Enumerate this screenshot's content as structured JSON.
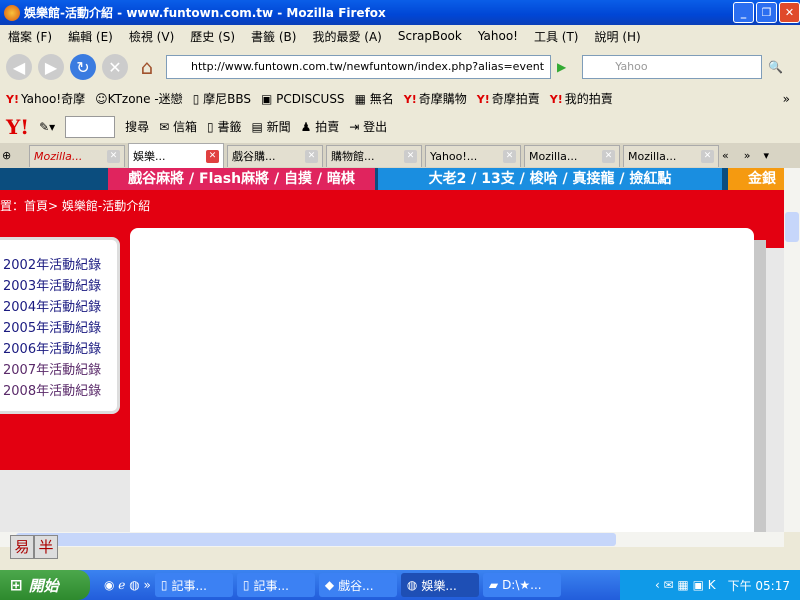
{
  "window": {
    "title": "娛樂館-活動介紹 - www.funtown.com.tw - Mozilla Firefox"
  },
  "menu": [
    "檔案 (F)",
    "編輯 (E)",
    "檢視 (V)",
    "歷史 (S)",
    "書籤 (B)",
    "我的最愛 (A)",
    "ScrapBook",
    "Yahoo!",
    "工具 (T)",
    "說明 (H)"
  ],
  "nav": {
    "url": "http://www.funtown.com.tw/newfuntown/index.php?alias=event",
    "search_placeholder": "Yahoo"
  },
  "bookmarks": [
    "Yahoo!奇摩",
    "KTzone -迷戀",
    "摩尼BBS",
    "PCDISCUSS",
    "無名",
    "奇摩購物",
    "奇摩拍賣",
    "我的拍賣"
  ],
  "yahoo_toolbar": {
    "logo": "Y!",
    "items": [
      "搜尋",
      "信箱",
      "書籤",
      "新聞",
      "拍賣",
      "登出"
    ]
  },
  "tabs": [
    {
      "label": "Mozilla...",
      "active": false
    },
    {
      "label": "娛樂...",
      "active": true
    },
    {
      "label": "戲谷購...",
      "active": false
    },
    {
      "label": "購物館...",
      "active": false
    },
    {
      "label": "Yahoo!...",
      "active": false
    },
    {
      "label": "Mozilla...",
      "active": false
    },
    {
      "label": "Mozilla...",
      "active": false
    }
  ],
  "page": {
    "banner": [
      "戲谷麻將 / Flash麻將 / 自摸 / 暗棋",
      "大老2 / 13支 / 梭哈 / 真接龍 / 撿紅點",
      "金銀"
    ],
    "breadcrumb": "置：首頁> 娛樂館-活動介紹",
    "records": [
      "2002年活動紀錄",
      "2003年活動紀錄",
      "2004年活動紀錄",
      "2005年活動紀錄",
      "2006年活動紀錄",
      "2007年活動紀錄",
      "2008年活動紀錄"
    ]
  },
  "ime": [
    "易",
    "半"
  ],
  "taskbar": {
    "start": "開始",
    "tasks": [
      "記事...",
      "記事...",
      "戲谷...",
      "娛樂...",
      "D:\\★..."
    ],
    "clock": "下午 05:17"
  },
  "colors": {
    "page_red": "#e30011",
    "link": "#1a1a80"
  }
}
